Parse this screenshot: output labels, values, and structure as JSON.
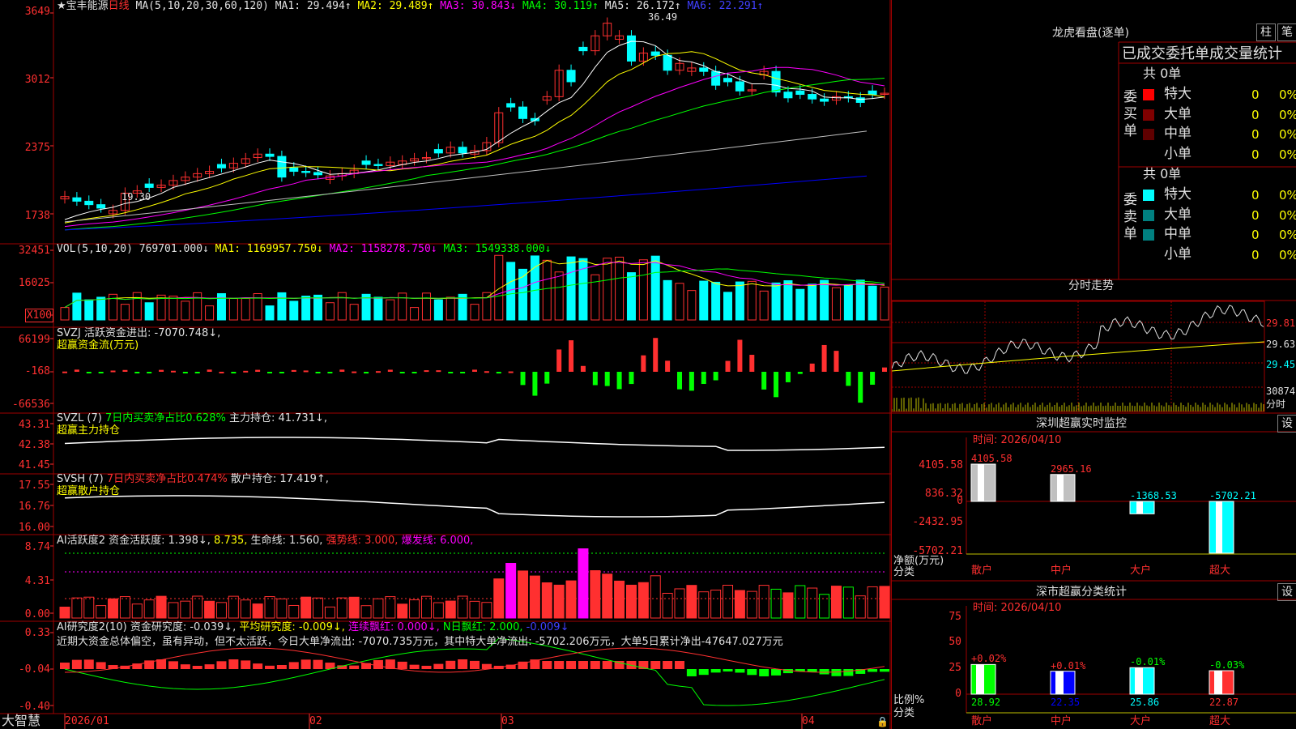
{
  "colors": {
    "up": "#ff3030",
    "down": "#00ffff",
    "grid": "#a00000",
    "bg": "#000000"
  },
  "kline": {
    "name": "宝丰能源",
    "period": "日线",
    "ma_def": "MA(5,10,20,30,60,120)",
    "ma1": "MA1: 29.494↑",
    "ma2": "MA2: 29.489↑",
    "ma3": "MA3: 30.843↓",
    "ma4": "MA4: 30.119↑",
    "ma5": "MA5: 26.172↑",
    "ma6": "MA6: 22.291↑",
    "high_mark": "36.49",
    "low_mark": "19.30",
    "y": [
      "3649",
      "3012",
      "2375",
      "1738"
    ],
    "closes": [
      20.5,
      20.1,
      19.8,
      19.5,
      19.3,
      20.8,
      21.0,
      21.3,
      21.5,
      21.9,
      22.2,
      22.5,
      22.7,
      23.0,
      23.4,
      23.8,
      24.2,
      24.0,
      22.2,
      22.7,
      22.6,
      22.4,
      22.3,
      22.5,
      22.8,
      23.3,
      23.2,
      23.5,
      23.6,
      23.8,
      23.9,
      24.3,
      24.8,
      24.3,
      24.5,
      25.2,
      27.8,
      28.3,
      27.3,
      27.1,
      29.2,
      31.5,
      30.5,
      33.2,
      34.5,
      35.6,
      34.5,
      32.3,
      33.0,
      32.8,
      31.5,
      32.1,
      31.7,
      31.4,
      30.2,
      30.5,
      29.7,
      29.8,
      31.4,
      29.6,
      29.1,
      29.4,
      29.0,
      28.8,
      29.2,
      29.1,
      28.7,
      29.4,
      29.5
    ]
  },
  "vol": {
    "label": "VOL(5,10,20)",
    "v": "769701.000↓",
    "ma1": "MA1: 1169957.750↓",
    "ma2": "MA2: 1158278.750↓",
    "ma3": "MA3: 1549338.000↓",
    "y": [
      "32451",
      "16025"
    ],
    "unit": "X100"
  },
  "svzj": {
    "label": "SVZJ  活跃资金进出: -7070.748↓,",
    "sub": "超赢资金流(万元)",
    "y": [
      "66199",
      "-168",
      "-66536"
    ]
  },
  "svzl": {
    "label": "SVZL (7)",
    "a": "7日内买卖净占比0.628%",
    "b": "主力持仓: 41.731↓,",
    "sub": "超赢主力持仓",
    "y": [
      "43.31",
      "42.38",
      "41.45"
    ]
  },
  "svsh": {
    "label": "SVSH (7)",
    "a": "7日内买卖净占比0.474%",
    "b": "散户持仓: 17.419↑,",
    "sub": "超赢散户持仓",
    "y": [
      "17.55",
      "16.76",
      "16.00"
    ]
  },
  "aihy": {
    "label": "AI活跃度2",
    "a": "资金活跃度: 1.398↓,",
    "b": "8.735,",
    "c": "生命线: 1.560,",
    "d": "强势线: 3.000,",
    "e": "爆发线: 6.000,",
    "y": [
      "8.74",
      "4.31",
      "0.00"
    ]
  },
  "aiyj": {
    "label": "AI研究度2(10)",
    "a": "资金研究度: -0.039↓,",
    "b": "平均研究度: -0.009↓,",
    "c": "连续飘红: 0.000↓,",
    "d": "N日飘红: 2.000,",
    "e": "-0.009↓",
    "y": [
      "0.33",
      "-0.04",
      "-0.40"
    ],
    "comment": "近期大资金总体偏空，虽有异动，但不太活跃，今日大单净流出: -7070.735万元，其中特大单净流出: -5702.206万元，大单5日累计净出-47647.027万元"
  },
  "dates": [
    "大智慧",
    "2026/01",
    "02",
    "03",
    "04"
  ],
  "right": {
    "title": "龙虎看盘(逐单)",
    "btn1": "柱",
    "btn2": "笔",
    "tabs": "已成交委托单成交量统计",
    "buy": {
      "side": "委买单",
      "total": "共 0单",
      "rows": [
        {
          "name": "特大",
          "n": "0",
          "p": "0%",
          "c": "#ff0000"
        },
        {
          "name": "大单",
          "n": "0",
          "p": "0%",
          "c": "#800000"
        },
        {
          "name": "中单",
          "n": "0",
          "p": "0%",
          "c": "#600000"
        },
        {
          "name": "小单",
          "n": "0",
          "p": "0%",
          "c": ""
        }
      ]
    },
    "sell": {
      "side": "委卖单",
      "total": "共 0单",
      "rows": [
        {
          "name": "特大",
          "n": "0",
          "p": "0%",
          "c": "#00ffff"
        },
        {
          "name": "大单",
          "n": "0",
          "p": "0%",
          "c": "#008080"
        },
        {
          "name": "中单",
          "n": "0",
          "p": "0%",
          "c": "#008080"
        },
        {
          "name": "小单",
          "n": "0",
          "p": "0%",
          "c": ""
        }
      ]
    },
    "fenshi": {
      "title": "分时走势",
      "y": [
        "29.81",
        "29.63",
        "29.45",
        "30874"
      ],
      "unit": "分时"
    },
    "monitor": {
      "title": "深圳超赢实时监控",
      "btn": "设",
      "time": "时间: 2026/04/10",
      "y": [
        "4105.58",
        "836.32",
        "0",
        "-2432.95",
        "-5702.21"
      ],
      "vals": [
        "4105.58",
        "2965.16",
        "-1368.53",
        "-5702.21"
      ],
      "ylabel": "净额(万元)",
      "xlabel": "分类",
      "cats": [
        "散户",
        "中户",
        "大户",
        "超大"
      ]
    },
    "classify": {
      "title": "深市超赢分类统计",
      "btn": "设",
      "time": "时间: 2026/04/10",
      "y": [
        "75",
        "50",
        "25",
        "0"
      ],
      "pct": [
        "+0.02%",
        "+0.01%",
        "-0.01%",
        "-0.03%"
      ],
      "vals": [
        "28.92",
        "22.35",
        "25.86",
        "22.87"
      ],
      "ylabel": "比例%",
      "xlabel": "分类",
      "cats": [
        "散户",
        "中户",
        "大户",
        "超大"
      ]
    }
  }
}
